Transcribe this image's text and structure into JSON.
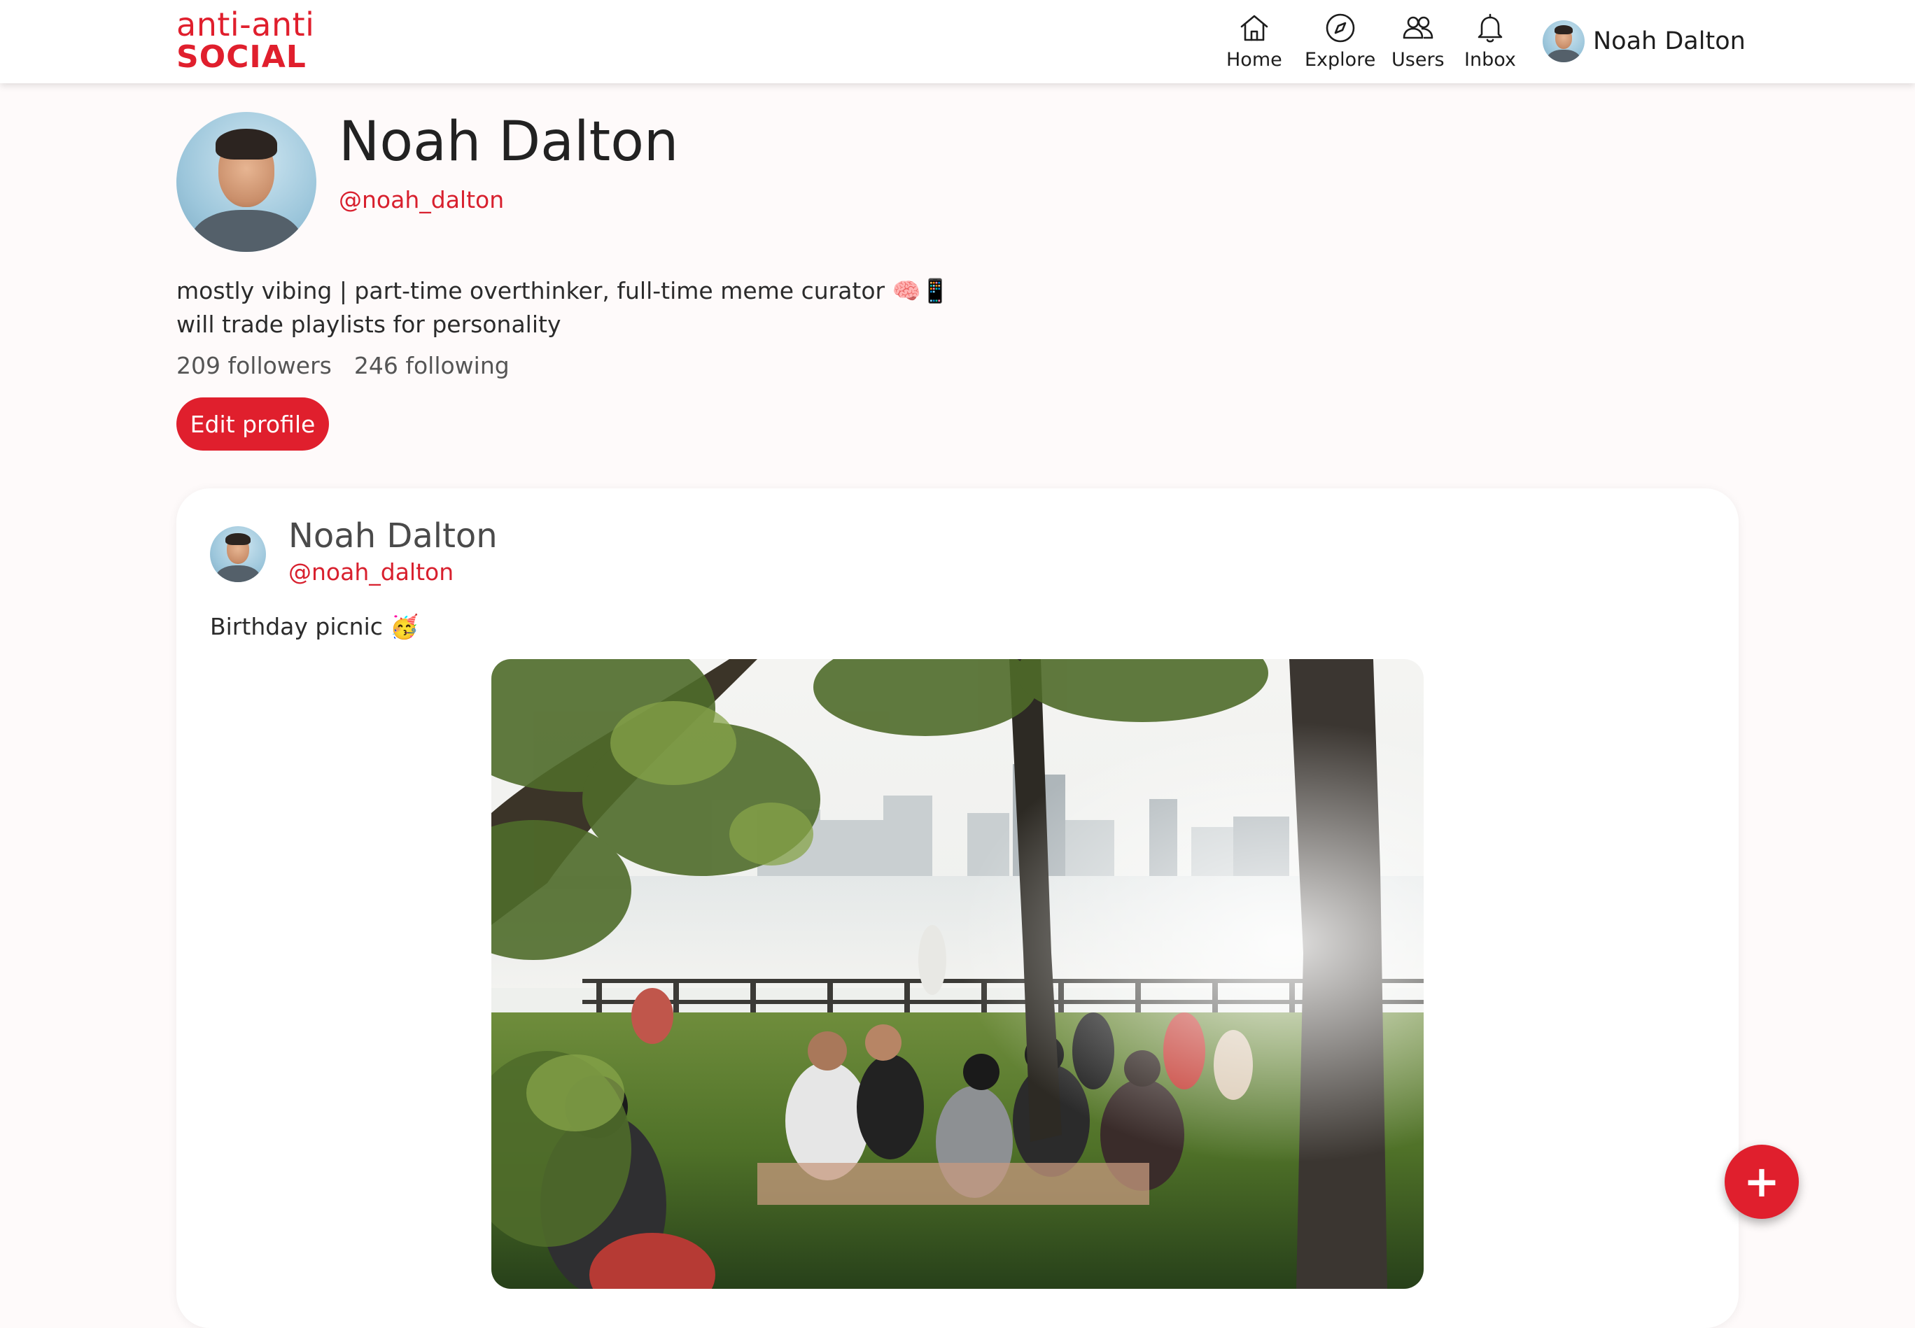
{
  "header": {
    "logo_top": "anti-anti",
    "logo_bottom": "SOCIAL",
    "nav": [
      {
        "label": "Home",
        "icon": "home-icon"
      },
      {
        "label": "Explore",
        "icon": "compass-icon"
      },
      {
        "label": "Users",
        "icon": "users-icon"
      },
      {
        "label": "Inbox",
        "icon": "bell-icon"
      }
    ],
    "current_user": "Noah Dalton"
  },
  "profile": {
    "name": "Noah Dalton",
    "handle": "@noah_dalton",
    "bio_line1": "mostly vibing | part-time overthinker, full-time meme curator 🧠📱",
    "bio_line2": "will trade playlists for personality",
    "followers": "209 followers",
    "following": "246 following",
    "edit_button": "Edit profile"
  },
  "post": {
    "author": "Noah Dalton",
    "handle": "@noah_dalton",
    "text": "Birthday picnic 🥳"
  },
  "fab": {
    "label": "+"
  },
  "colors": {
    "accent": "#e01f2d",
    "background": "#fefafa",
    "card": "#ffffff"
  }
}
